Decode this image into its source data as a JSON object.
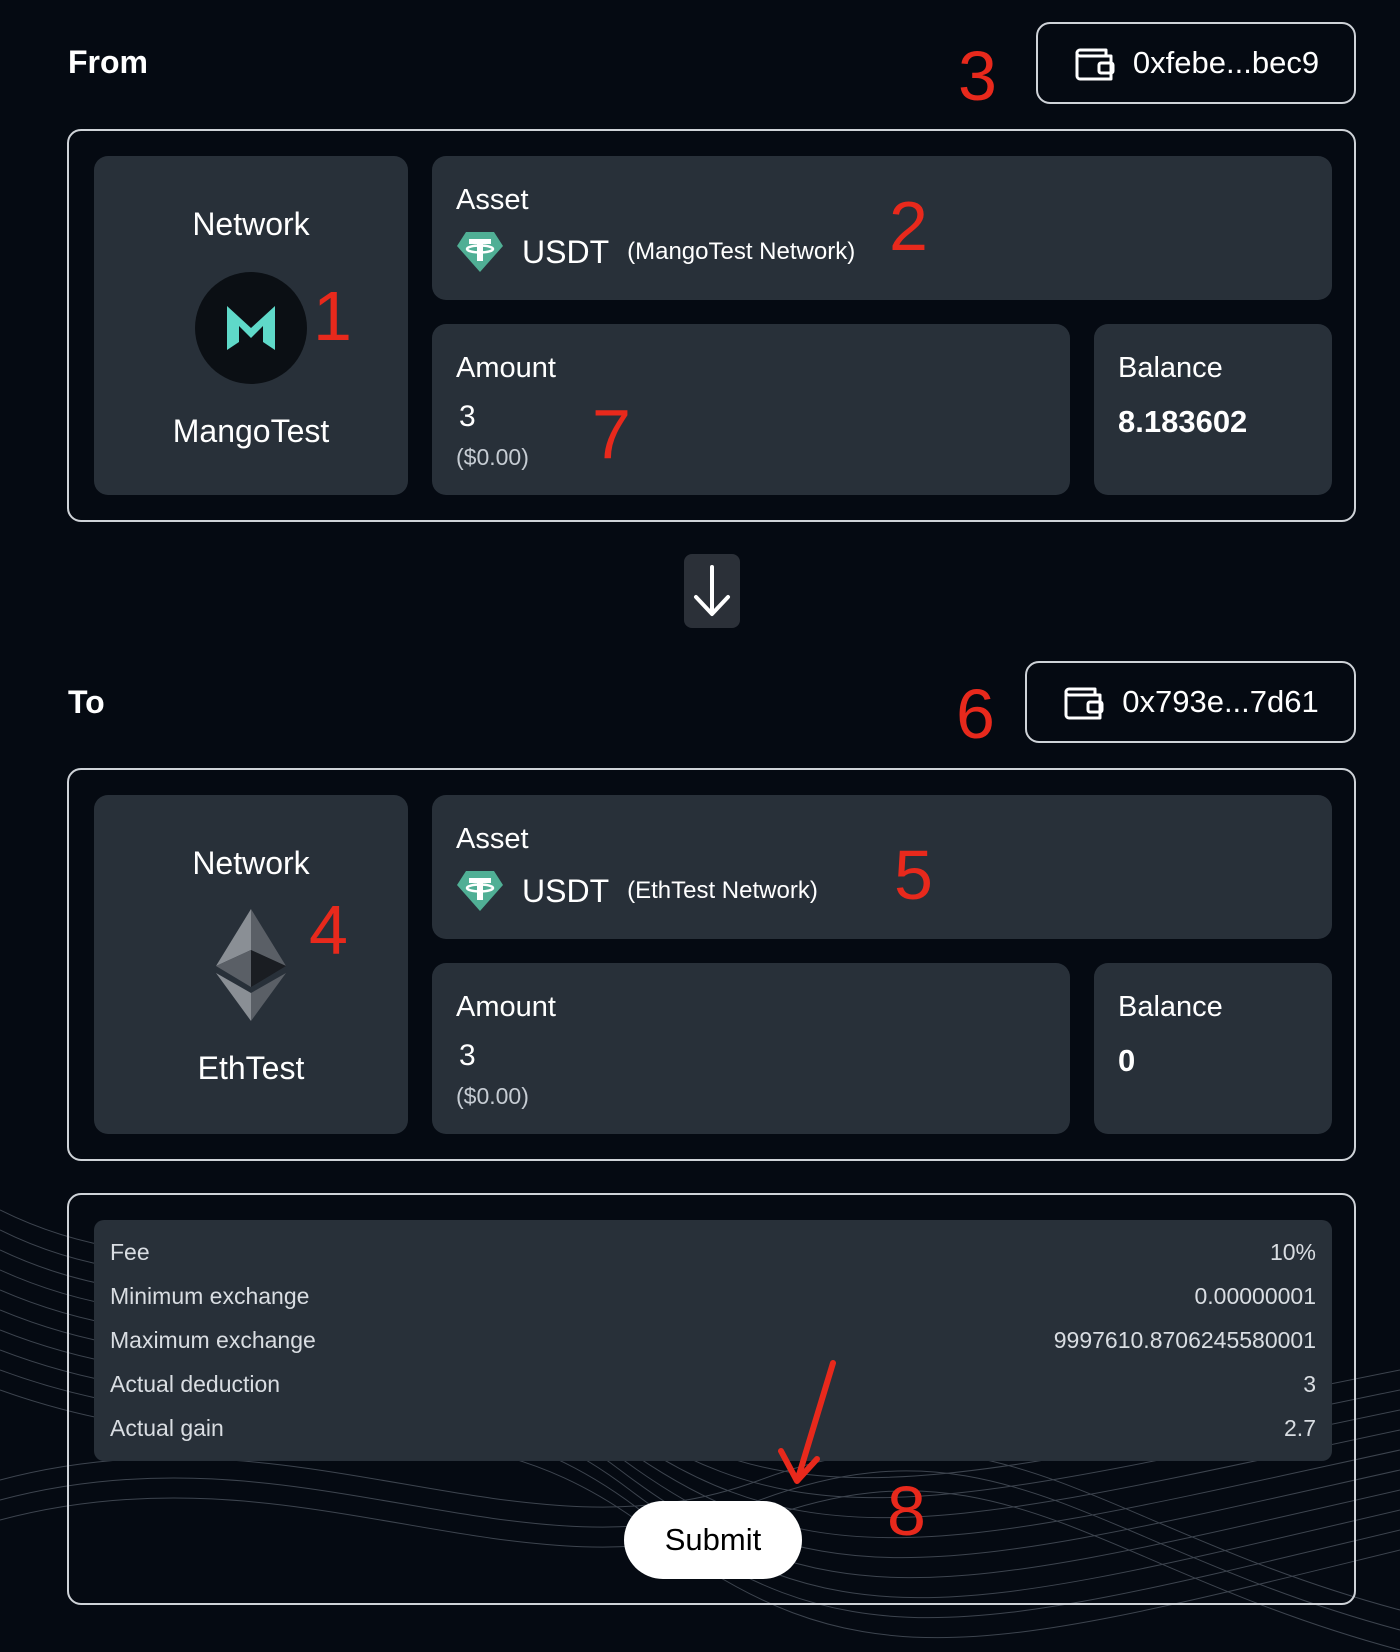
{
  "from": {
    "label": "From",
    "wallet": "0xfebe...bec9",
    "network_label": "Network",
    "network_name": "MangoTest",
    "network_icon": "mango-logo-icon",
    "asset_label": "Asset",
    "asset_symbol": "USDT",
    "asset_network": "(MangoTest Network)",
    "amount_label": "Amount",
    "amount": "3",
    "amount_usd": "($0.00)",
    "balance_label": "Balance",
    "balance": "8.183602"
  },
  "to": {
    "label": "To",
    "wallet": "0x793e...7d61",
    "network_label": "Network",
    "network_name": "EthTest",
    "network_icon": "ethereum-logo-icon",
    "asset_label": "Asset",
    "asset_symbol": "USDT",
    "asset_network": "(EthTest Network)",
    "amount_label": "Amount",
    "amount": "3",
    "amount_usd": "($0.00)",
    "balance_label": "Balance",
    "balance": "0"
  },
  "summary": {
    "rows": [
      {
        "label": "Fee",
        "value": "10%"
      },
      {
        "label": "Minimum exchange",
        "value": "0.00000001"
      },
      {
        "label": "Maximum exchange",
        "value": "9997610.8706245580001"
      },
      {
        "label": "Actual deduction",
        "value": "3"
      },
      {
        "label": "Actual gain",
        "value": "2.7"
      }
    ],
    "submit_label": "Submit"
  },
  "annotations": {
    "n1": "1",
    "n2": "2",
    "n3": "3",
    "n4": "4",
    "n5": "5",
    "n6": "6",
    "n7": "7",
    "n8": "8"
  },
  "colors": {
    "background": "#050a12",
    "card": "#283039",
    "annotation": "#e8291c",
    "tether": "#50af95",
    "mango_accent": "#5fd9c9"
  }
}
